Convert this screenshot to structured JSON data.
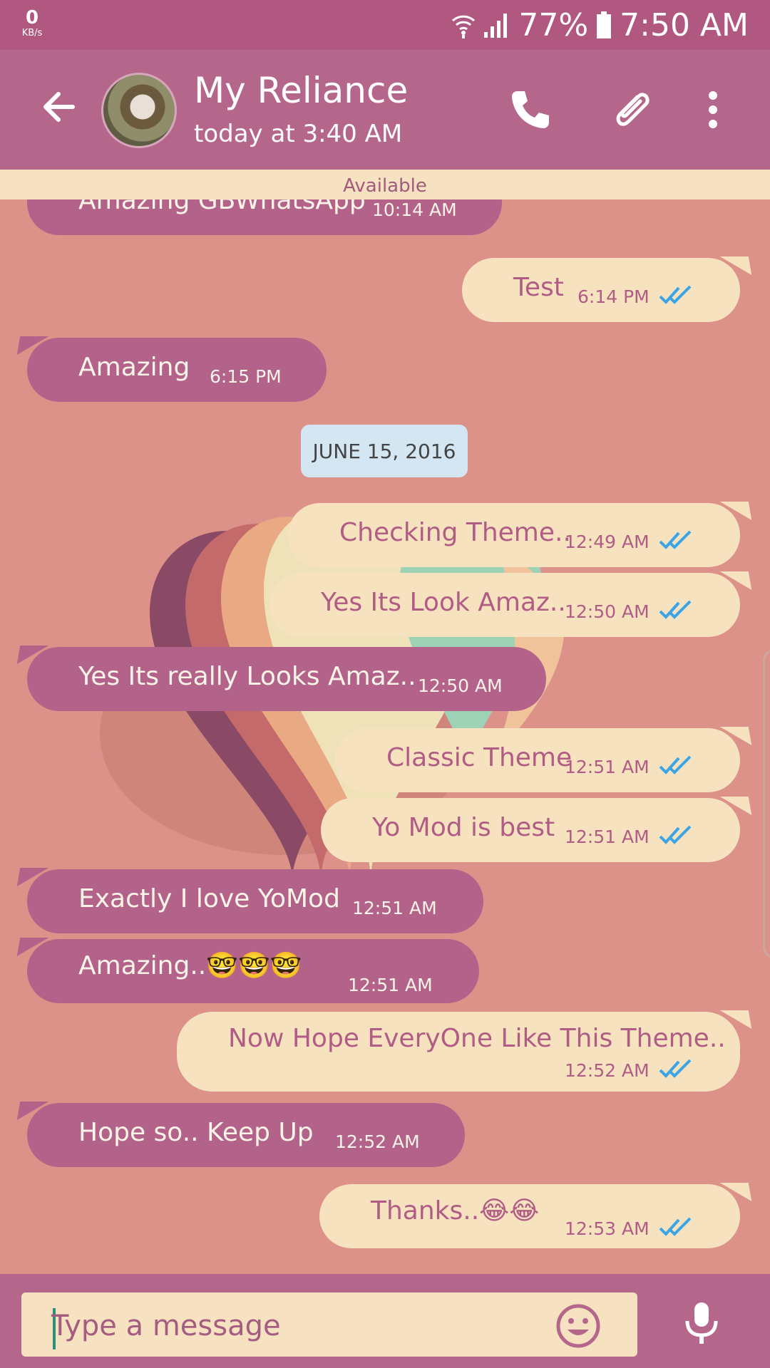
{
  "status_bar": {
    "speed_value": "0",
    "speed_unit": "KB/s",
    "battery": "77%",
    "time": "7:50 AM"
  },
  "header": {
    "contact_name": "My Reliance",
    "last_seen": "today at 3:40 AM",
    "status": "Available"
  },
  "date_separator": "JUNE 15, 2016",
  "messages": [
    {
      "dir": "in",
      "text": "Amazing GBWhatsApp",
      "time": "10:14 AM"
    },
    {
      "dir": "out",
      "text": "Test",
      "time": "6:14 PM"
    },
    {
      "dir": "in",
      "text": "Amazing",
      "time": "6:15 PM"
    },
    {
      "dir": "out",
      "text": "Checking Theme..",
      "time": "12:49 AM"
    },
    {
      "dir": "out",
      "text": "Yes Its Look Amaz..",
      "time": "12:50 AM"
    },
    {
      "dir": "in",
      "text": "Yes Its really Looks Amaz..",
      "time": "12:50 AM"
    },
    {
      "dir": "out",
      "text": "Classic Theme",
      "time": "12:51 AM"
    },
    {
      "dir": "out",
      "text": "Yo Mod is best",
      "time": "12:51 AM"
    },
    {
      "dir": "in",
      "text": "Exactly I love YoMod",
      "time": "12:51 AM"
    },
    {
      "dir": "in",
      "text": "Amazing..🤓🤓🤓",
      "time": "12:51 AM"
    },
    {
      "dir": "out",
      "text": "Now Hope EveryOne Like This Theme..",
      "time": "12:52 AM"
    },
    {
      "dir": "in",
      "text": "Hope so.. Keep Up",
      "time": "12:52 AM"
    },
    {
      "dir": "out",
      "text": "Thanks..😂😂",
      "time": "12:53 AM"
    }
  ],
  "composer": {
    "placeholder": "Type a message"
  },
  "icons": {
    "back": "back-arrow-icon",
    "call": "phone-icon",
    "attach": "paperclip-icon",
    "menu": "more-vert-icon",
    "emoji": "emoji-icon",
    "mic": "mic-icon",
    "read_receipt": "double-check-icon",
    "wifi": "wifi-icon",
    "signal": "signal-icon",
    "battery": "battery-icon"
  },
  "colors": {
    "header": "#b5668b",
    "statusbar": "#b0587f",
    "wallpaper": "#dc9189",
    "incoming_bubble": "#b3628a",
    "outgoing_bubble": "#f7e2c0",
    "tick": "#3ba4e6"
  }
}
